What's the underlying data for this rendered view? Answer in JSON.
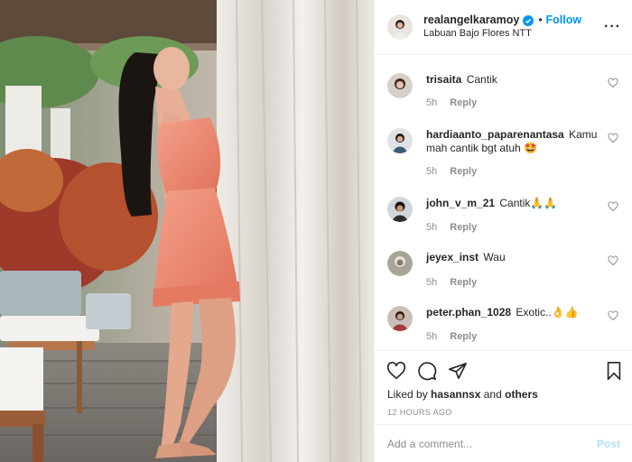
{
  "post": {
    "username": "realangelkaramoy",
    "follow_label": "Follow",
    "dot": "•",
    "location": "Labuan Bajo Flores NTT",
    "more_label": "···",
    "verified_color": "#0095f6"
  },
  "comments": [
    {
      "user": "trisaita",
      "text": "Cantik",
      "time": "5h",
      "reply": "Reply"
    },
    {
      "user": "hardiaanto_paparenantasa",
      "text": "Kamu mah cantik bgt atuh 🤩",
      "time": "5h",
      "reply": "Reply"
    },
    {
      "user": "john_v_m_21",
      "text": "Cantik🙏🙏",
      "time": "5h",
      "reply": "Reply"
    },
    {
      "user": "jeyex_inst",
      "text": "Wau",
      "time": "5h",
      "reply": "Reply"
    },
    {
      "user": "peter.phan_1028",
      "text": "Exotic..👌👍",
      "time": "5h",
      "reply": "Reply"
    }
  ],
  "actions": {
    "icons": [
      "heart-icon",
      "comment-icon",
      "share-icon",
      "bookmark-icon"
    ],
    "liked_by_prefix": "Liked by",
    "liked_by_user": "hasannsx",
    "liked_by_and": "and",
    "liked_by_others": "others",
    "timestamp": "12 HOURS AGO"
  },
  "comment_box": {
    "placeholder": "Add a comment...",
    "post_label": "Post"
  },
  "colors": {
    "accent": "#0095f6",
    "post_disabled": "#b2dffc",
    "muted": "#8e8e8e",
    "dress": "#f08a70"
  }
}
